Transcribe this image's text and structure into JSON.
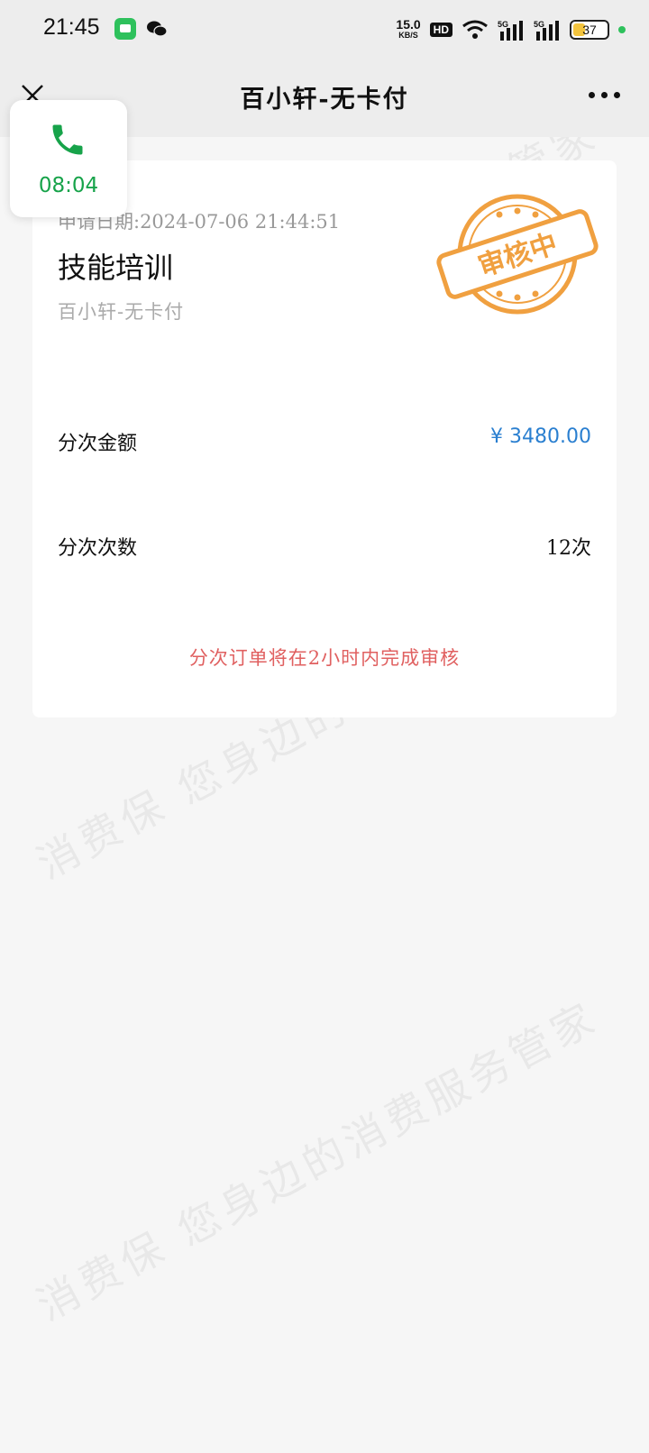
{
  "status_bar": {
    "time": "21:45",
    "net_speed": "15.0",
    "net_unit": "KB/S",
    "hd_label": "HD",
    "signal_label_1": "5G",
    "signal_label_2": "5G",
    "battery_level": "37",
    "battery_fraction": 0.37,
    "icons": [
      "messages-app-icon",
      "wechat-icon",
      "wifi-icon",
      "signal-icon",
      "battery-icon"
    ]
  },
  "nav": {
    "title": "百小轩-无卡付",
    "close_icon": "close-icon",
    "more_icon": "more-icon"
  },
  "call_float": {
    "duration": "08:04",
    "icon": "phone-icon"
  },
  "order": {
    "apply_date": "申请日期:2024-07-06 21:44:51",
    "title": "技能培训",
    "merchant": "百小轩-无卡付",
    "stamp_text": "审核中",
    "amount_label": "分次金额",
    "amount_value": "¥ 3480.00",
    "count_label": "分次次数",
    "count_value": "12次",
    "notice": "分次订单将在2小时内完成审核"
  },
  "watermark": {
    "text": "消费保 您身边的消费服务管家"
  },
  "colors": {
    "background": "#f6f6f6",
    "nav_bg": "#ededed",
    "amount": "#2a7fd0",
    "notice": "#e06060",
    "stamp": "#f0a040",
    "call_green": "#17a34a"
  }
}
